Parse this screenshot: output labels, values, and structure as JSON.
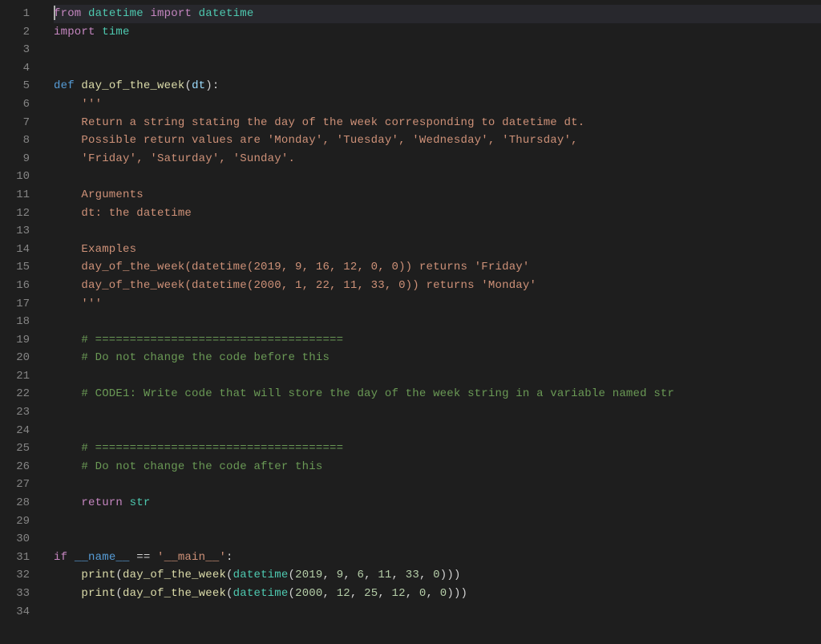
{
  "lines": {
    "1": {
      "t1": "from",
      "t2": " ",
      "t3": "datetime",
      "t4": " ",
      "t5": "import",
      "t6": " ",
      "t7": "datetime"
    },
    "2": {
      "t1": "import",
      "t2": " ",
      "t3": "time"
    },
    "5": {
      "t1": "def",
      "t2": " ",
      "t3": "day_of_the_week",
      "t4": "(",
      "t5": "dt",
      "t6": "):"
    },
    "6": {
      "t1": "    ",
      "t2": "'''"
    },
    "7": {
      "t1": "    Return a string stating the day of the week corresponding to datetime dt."
    },
    "8": {
      "t1": "    Possible return values are 'Monday', 'Tuesday', 'Wednesday', 'Thursday',"
    },
    "9": {
      "t1": "    'Friday', 'Saturday', 'Sunday'."
    },
    "11": {
      "t1": "    Arguments"
    },
    "12": {
      "t1": "    dt: the datetime"
    },
    "14": {
      "t1": "    Examples"
    },
    "15": {
      "t1": "    day_of_the_week(datetime(2019, 9, 16, 12, 0, 0)) returns 'Friday'"
    },
    "16": {
      "t1": "    day_of_the_week(datetime(2000, 1, 22, 11, 33, 0)) returns 'Monday'"
    },
    "17": {
      "t1": "    ",
      "t2": "'''"
    },
    "19": {
      "t1": "    ",
      "t2": "# ===================================="
    },
    "20": {
      "t1": "    ",
      "t2": "# Do not change the code before this"
    },
    "22": {
      "t1": "    ",
      "t2": "# CODE1: Write code that will store the day of the week string in a variable named str"
    },
    "25": {
      "t1": "    ",
      "t2": "# ===================================="
    },
    "26": {
      "t1": "    ",
      "t2": "# Do not change the code after this"
    },
    "28": {
      "t1": "    ",
      "t2": "return",
      "t3": " ",
      "t4": "str"
    },
    "31": {
      "t1": "if",
      "t2": " ",
      "t3": "__name__",
      "t4": " == ",
      "t5": "'__main__'",
      "t6": ":"
    },
    "32": {
      "t1": "    ",
      "t2": "print",
      "t3": "(",
      "t4": "day_of_the_week",
      "t5": "(",
      "t6": "datetime",
      "t7": "(",
      "t8": "2019",
      "t9": ", ",
      "t10": "9",
      "t11": ", ",
      "t12": "6",
      "t13": ", ",
      "t14": "11",
      "t15": ", ",
      "t16": "33",
      "t17": ", ",
      "t18": "0",
      "t19": ")))"
    },
    "33": {
      "t1": "    ",
      "t2": "print",
      "t3": "(",
      "t4": "day_of_the_week",
      "t5": "(",
      "t6": "datetime",
      "t7": "(",
      "t8": "2000",
      "t9": ", ",
      "t10": "12",
      "t11": ", ",
      "t12": "25",
      "t13": ", ",
      "t14": "12",
      "t15": ", ",
      "t16": "0",
      "t17": ", ",
      "t18": "0",
      "t19": ")))"
    }
  },
  "lineNumbers": [
    "1",
    "2",
    "3",
    "4",
    "5",
    "6",
    "7",
    "8",
    "9",
    "10",
    "11",
    "12",
    "13",
    "14",
    "15",
    "16",
    "17",
    "18",
    "19",
    "20",
    "21",
    "22",
    "23",
    "24",
    "25",
    "26",
    "27",
    "28",
    "29",
    "30",
    "31",
    "32",
    "33",
    "34"
  ]
}
